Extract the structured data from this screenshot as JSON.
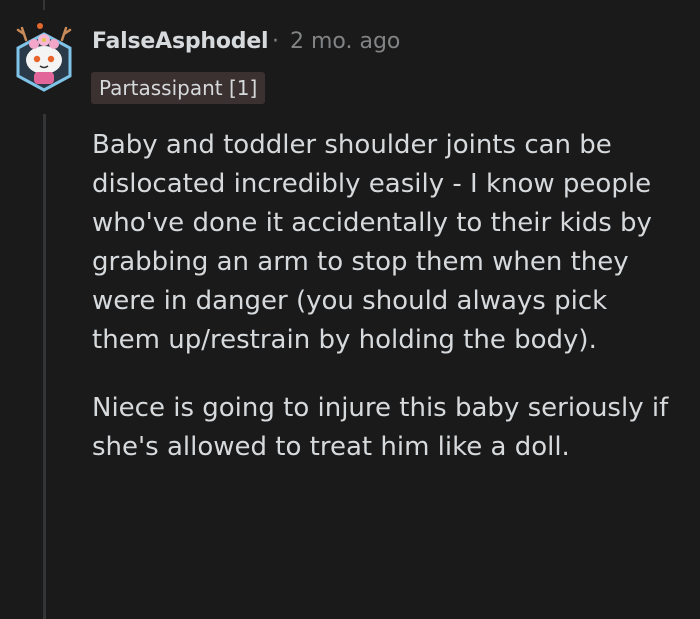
{
  "comment": {
    "username": "FalseAsphodel",
    "separator": "·",
    "timestamp": "2 mo. ago",
    "flair": "Partassipant [1]",
    "paragraphs": [
      "Baby and toddler shoulder joints can be dislocated incredibly easily - I know people who've done it accidentally to their kids by grabbing an arm to stop them when they were in danger (you should always pick them up/restrain by holding the body).",
      "Niece is going to injure this baby seriously if she's allowed to treat him like a doll."
    ]
  },
  "icons": {
    "avatar": "snoo-avatar-with-flower-crown-icon"
  },
  "colors": {
    "background": "#1a1a1b",
    "text": "#d7dadc",
    "meta": "#818384",
    "flair_bg": "#3b3131",
    "thread_line": "#343536"
  }
}
